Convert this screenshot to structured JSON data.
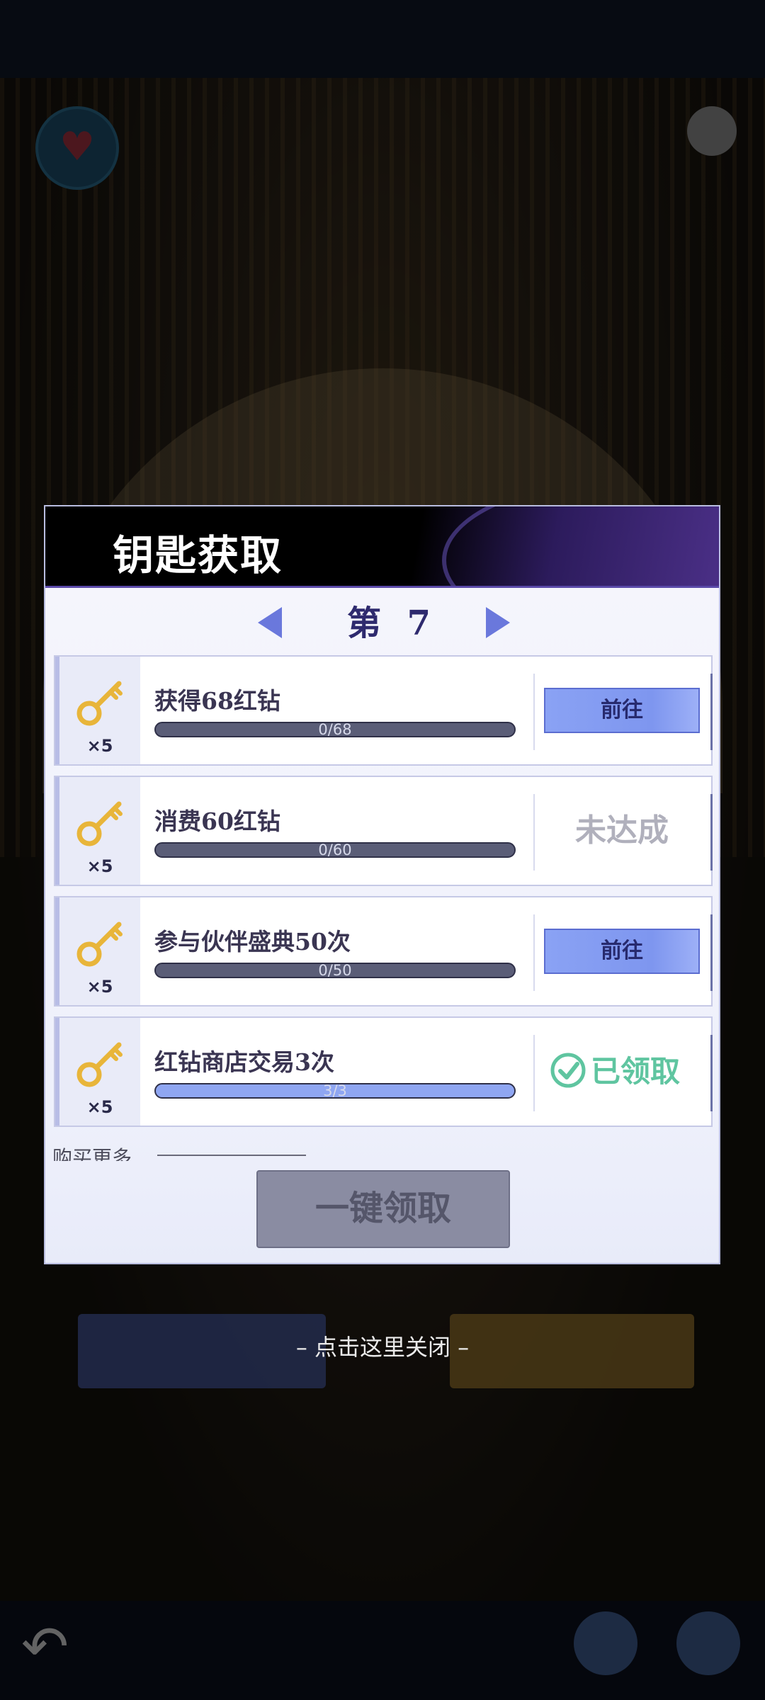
{
  "modal": {
    "title": "钥匙获取",
    "day_label": "第 7 天",
    "more_text": "购买更多",
    "claim_all_label": "一键领取"
  },
  "tasks": [
    {
      "title": "获得68红钻",
      "reward": "×5",
      "progress_text": "0/68",
      "progress": 0,
      "action": "前往",
      "state": "go"
    },
    {
      "title": "消费60红钻",
      "reward": "×5",
      "progress_text": "0/60",
      "progress": 0,
      "action": "未达成",
      "state": "not_reached"
    },
    {
      "title": "参与伙伴盛典50次",
      "reward": "×5",
      "progress_text": "0/50",
      "progress": 0,
      "action": "前往",
      "state": "go"
    },
    {
      "title": "红钻商店交易3次",
      "reward": "×5",
      "progress_text": "3/3",
      "progress": 1,
      "action": "已领取",
      "state": "claimed"
    }
  ],
  "close_hint": "– 点击这里关闭 –",
  "colors": {
    "accent": "#7e96ef",
    "claimed": "#5fc5a0",
    "key": "#e8b53a"
  }
}
